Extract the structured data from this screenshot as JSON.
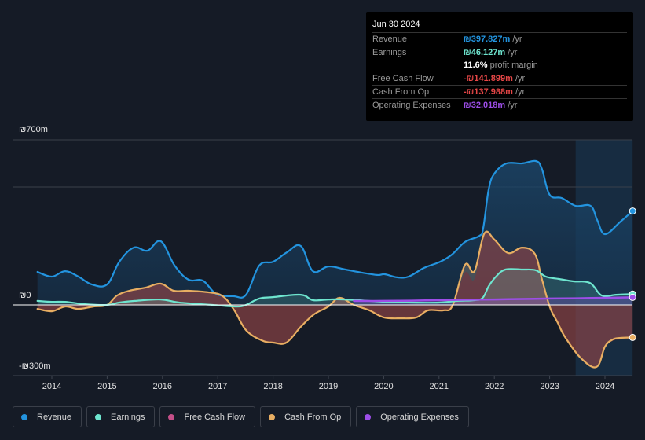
{
  "tooltip": {
    "date": "Jun 30 2024",
    "rows": [
      {
        "label": "Revenue",
        "value": "₪397.827m",
        "unit": " /yr",
        "color": "#2394df"
      },
      {
        "label": "Earnings",
        "value": "₪46.127m",
        "unit": " /yr",
        "color": "#6ee5cf"
      },
      {
        "label": "",
        "value": "11.6%",
        "unit": " profit margin",
        "color": "#ffffff"
      },
      {
        "label": "Free Cash Flow",
        "value": "-₪141.899m",
        "unit": " /yr",
        "color": "#e64747"
      },
      {
        "label": "Cash From Op",
        "value": "-₪137.988m",
        "unit": " /yr",
        "color": "#e64747"
      },
      {
        "label": "Operating Expenses",
        "value": "₪32.018m",
        "unit": " /yr",
        "color": "#9d4ee8"
      }
    ]
  },
  "legend": [
    {
      "label": "Revenue",
      "color": "#2394df"
    },
    {
      "label": "Earnings",
      "color": "#6ee5cf"
    },
    {
      "label": "Free Cash Flow",
      "color": "#c44f88"
    },
    {
      "label": "Cash From Op",
      "color": "#e8ae62"
    },
    {
      "label": "Operating Expenses",
      "color": "#9d4ee8"
    }
  ],
  "chart_data": {
    "type": "area",
    "title": "",
    "xlabel": "",
    "ylabel": "",
    "y_tick_labels": [
      {
        "value": 700,
        "label": "₪700m"
      },
      {
        "value": 0,
        "label": "₪0"
      },
      {
        "value": -300,
        "label": "-₪300m"
      }
    ],
    "gridlines": [
      700,
      500,
      0
    ],
    "ylim": [
      -300,
      700
    ],
    "xlim": [
      2013.74,
      2024.5
    ],
    "x_ticks": [
      "2014",
      "2015",
      "2016",
      "2017",
      "2018",
      "2019",
      "2020",
      "2021",
      "2022",
      "2023",
      "2024"
    ],
    "forecast_region": [
      2023.47,
      2024.5
    ],
    "series": [
      {
        "name": "Revenue",
        "color": "#2394df",
        "x": [
          2013.74,
          2014.0,
          2014.24,
          2014.48,
          2014.72,
          2015.0,
          2015.22,
          2015.48,
          2015.73,
          2015.97,
          2016.22,
          2016.47,
          2016.73,
          2016.97,
          2017.28,
          2017.51,
          2017.75,
          2018.0,
          2018.25,
          2018.5,
          2018.72,
          2019.0,
          2019.31,
          2019.6,
          2019.88,
          2020.02,
          2020.24,
          2020.45,
          2020.73,
          2021.02,
          2021.23,
          2021.47,
          2021.73,
          2021.8,
          2021.9,
          2022.01,
          2022.22,
          2022.5,
          2022.75,
          2022.86,
          2023.0,
          2023.22,
          2023.47,
          2023.74,
          2023.86,
          2024.0,
          2024.28,
          2024.5
        ],
        "y": [
          140,
          120,
          143,
          120,
          87,
          87,
          183,
          243,
          230,
          270,
          167,
          107,
          103,
          47,
          37,
          43,
          167,
          183,
          223,
          250,
          143,
          163,
          150,
          137,
          127,
          130,
          117,
          120,
          157,
          183,
          213,
          267,
          293,
          327,
          493,
          560,
          600,
          600,
          610,
          577,
          467,
          453,
          420,
          420,
          360,
          300,
          353,
          398
        ]
      },
      {
        "name": "Earnings",
        "color": "#6ee5cf",
        "x": [
          2013.74,
          2014.0,
          2014.24,
          2014.6,
          2015.0,
          2015.22,
          2015.5,
          2015.97,
          2016.3,
          2016.9,
          2017.33,
          2017.51,
          2017.75,
          2018.0,
          2018.5,
          2018.72,
          2019.0,
          2019.31,
          2020.0,
          2020.5,
          2021.0,
          2021.33,
          2021.64,
          2021.79,
          2021.9,
          2022.03,
          2022.2,
          2022.5,
          2022.75,
          2022.93,
          2023.17,
          2023.43,
          2023.73,
          2023.94,
          2024.2,
          2024.5
        ],
        "y": [
          17,
          13,
          13,
          3,
          0,
          10,
          17,
          23,
          10,
          0,
          -7,
          0,
          27,
          33,
          43,
          20,
          23,
          23,
          13,
          10,
          10,
          17,
          20,
          30,
          80,
          120,
          150,
          150,
          147,
          120,
          110,
          100,
          93,
          40,
          43,
          46
        ]
      },
      {
        "name": "Free Cash Flow",
        "color": "#c44f88",
        "x": [
          2013.74,
          2014.0,
          2014.24,
          2014.48,
          2014.75,
          2015.0,
          2015.18,
          2015.4,
          2015.69,
          2015.97,
          2016.2,
          2016.47,
          2016.84,
          2017.09,
          2017.3,
          2017.51,
          2017.79,
          2018.0,
          2018.24,
          2018.5,
          2018.74,
          2019.0,
          2019.2,
          2019.46,
          2019.74,
          2020.0,
          2020.31,
          2020.59,
          2020.8,
          2021.08,
          2021.25,
          2021.47,
          2021.64,
          2021.82,
          2022.0,
          2022.25,
          2022.5,
          2022.73,
          2022.86,
          2023.0,
          2023.14,
          2023.28,
          2023.57,
          2023.85,
          2024.0,
          2024.14,
          2024.28,
          2024.5
        ],
        "y": [
          -20,
          -29,
          -10,
          -20,
          -10,
          -3,
          37,
          57,
          70,
          87,
          57,
          60,
          50,
          33,
          -27,
          -110,
          -153,
          -163,
          -163,
          -97,
          -43,
          -10,
          27,
          -3,
          -27,
          -57,
          -60,
          -57,
          -27,
          -27,
          -3,
          137,
          110,
          300,
          283,
          217,
          240,
          210,
          103,
          -10,
          -77,
          -140,
          -230,
          -267,
          -180,
          -153,
          -147,
          -142
        ]
      },
      {
        "name": "Cash From Op",
        "color": "#e8ae62",
        "x": [
          2013.74,
          2014.0,
          2014.24,
          2014.48,
          2014.75,
          2015.0,
          2015.18,
          2015.4,
          2015.69,
          2015.97,
          2016.2,
          2016.47,
          2016.84,
          2017.09,
          2017.3,
          2017.51,
          2017.79,
          2018.0,
          2018.24,
          2018.5,
          2018.74,
          2019.0,
          2019.2,
          2019.46,
          2019.74,
          2020.0,
          2020.31,
          2020.59,
          2020.8,
          2021.08,
          2021.25,
          2021.47,
          2021.64,
          2021.82,
          2022.0,
          2022.25,
          2022.5,
          2022.73,
          2022.86,
          2023.0,
          2023.14,
          2023.28,
          2023.57,
          2023.85,
          2024.0,
          2024.14,
          2024.28,
          2024.5
        ],
        "y": [
          -17,
          -27,
          -7,
          -17,
          -7,
          0,
          40,
          60,
          73,
          90,
          60,
          60,
          53,
          37,
          -23,
          -107,
          -150,
          -160,
          -160,
          -93,
          -40,
          -7,
          30,
          0,
          -23,
          -53,
          -57,
          -53,
          -23,
          -23,
          0,
          170,
          143,
          303,
          277,
          220,
          243,
          217,
          110,
          -7,
          -73,
          -137,
          -227,
          -263,
          -177,
          -147,
          -140,
          -138
        ]
      },
      {
        "name": "Operating Expenses",
        "color": "#9d4ee8",
        "x": [
          2019.46,
          2020.0,
          2020.5,
          2021.0,
          2021.5,
          2022.0,
          2022.5,
          2023.0,
          2023.5,
          2024.0,
          2024.5
        ],
        "y": [
          17,
          17,
          18,
          20,
          22,
          23,
          25,
          27,
          28,
          30,
          32
        ]
      }
    ]
  }
}
